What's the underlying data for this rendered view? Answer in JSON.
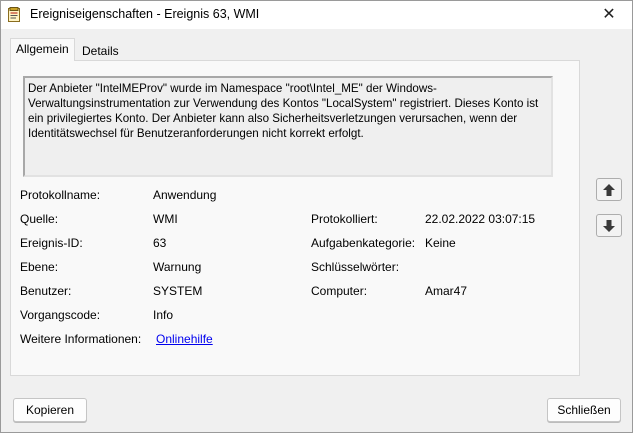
{
  "window": {
    "title": "Ereigniseigenschaften - Ereignis 63, WMI",
    "close_glyph": "✕"
  },
  "tabs": [
    {
      "label": "Allgemein",
      "active": true
    },
    {
      "label": "Details",
      "active": false
    }
  ],
  "description": "Der Anbieter \"IntelMEProv\" wurde im Namespace \"root\\Intel_ME\" der Windows-Verwaltungsinstrumentation zur Verwendung des Kontos \"LocalSystem\" registriert. Dieses Konto ist ein privilegiertes Konto. Der Anbieter kann also Sicherheitsverletzungen verursachen, wenn der Identitätswechsel für Benutzeranforderungen nicht korrekt erfolgt.",
  "fields": {
    "protokollname": {
      "label": "Protokollname:",
      "value": "Anwendung"
    },
    "quelle": {
      "label": "Quelle:",
      "value": "WMI"
    },
    "ereignis_id": {
      "label": "Ereignis-ID:",
      "value": "63"
    },
    "ebene": {
      "label": "Ebene:",
      "value": "Warnung"
    },
    "benutzer": {
      "label": "Benutzer:",
      "value": "SYSTEM"
    },
    "vorgangscode": {
      "label": "Vorgangscode:",
      "value": "Info"
    },
    "weitere_informationen": {
      "label": "Weitere Informationen:",
      "value": "Onlinehilfe"
    },
    "protokolliert": {
      "label": "Protokolliert:",
      "value": "22.02.2022 03:07:15"
    },
    "aufgabenkategorie": {
      "label": "Aufgabenkategorie:",
      "value": "Keine"
    },
    "schluesselwoerter": {
      "label": "Schlüsselwörter:",
      "value": ""
    },
    "computer": {
      "label": "Computer:",
      "value": "Amar47"
    }
  },
  "buttons": {
    "copy": "Kopieren",
    "close": "Schließen"
  },
  "icons": {
    "app": "event-viewer-icon",
    "up": "arrow-up-icon",
    "down": "arrow-down-icon"
  },
  "colors": {
    "link": "#0000ee",
    "window_bg": "#f0f0f0"
  }
}
